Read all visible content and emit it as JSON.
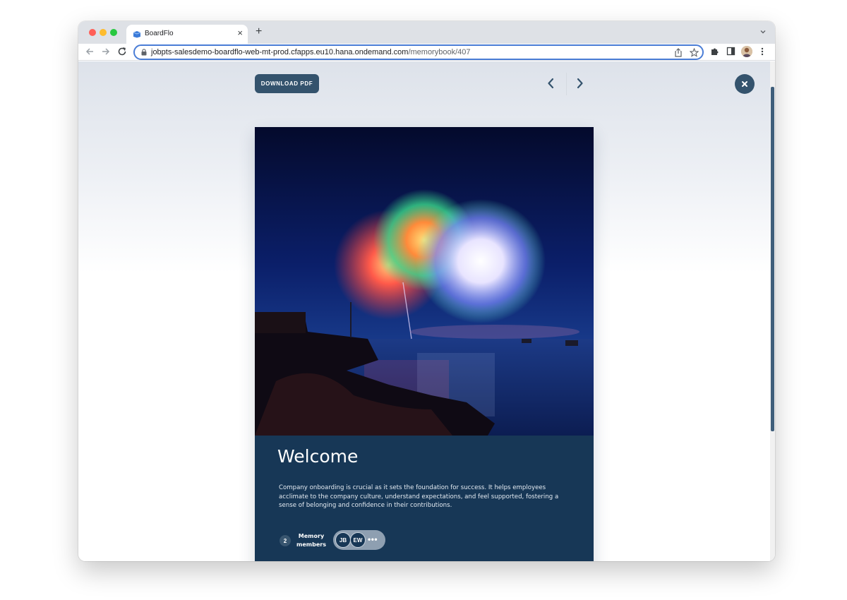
{
  "browser": {
    "tab_title": "BoardFlo",
    "tab_close_glyph": "×",
    "new_tab_glyph": "+",
    "url_host": "jobpts-salesdemo-boardflo-web-mt-prod.cfapps.eu10.hana.ondemand.com",
    "url_path": "/memorybook/407",
    "accent_color": "#4a7dd6"
  },
  "toolbar": {
    "download_label": "DOWNLOAD PDF",
    "prev_icon": "chevron-left-icon",
    "next_icon": "chevron-right-icon",
    "close_icon": "close-icon",
    "brand_color": "#34536d"
  },
  "card": {
    "image": "fireworks-over-water",
    "title": "Welcome",
    "description": "Company onboarding is crucial as it sets the foundation for success. It helps employees acclimate to the company culture, understand expectations, and feel supported, fostering a sense of belonging and confidence in their contributions.",
    "background_color": "#173756",
    "members": {
      "count": "2",
      "label": "Memory members",
      "avatars": [
        "JB",
        "EW"
      ],
      "more": "•••"
    }
  }
}
